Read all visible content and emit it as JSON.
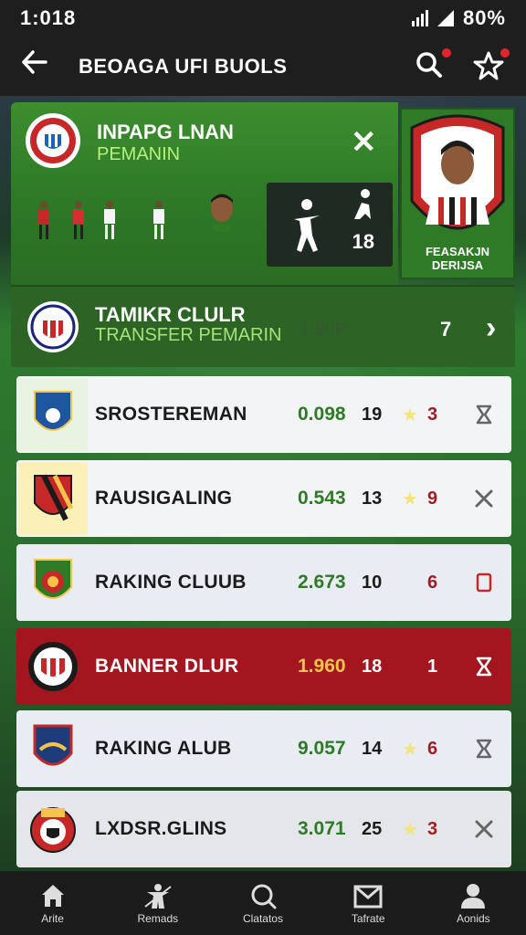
{
  "status": {
    "time": "1:018",
    "battery": "80%"
  },
  "appbar": {
    "title": "BEOAGA UFI BUOLS"
  },
  "promo": {
    "title": "INPAPG LNAN",
    "subtitle": "PEMANIN",
    "stat_number": "18",
    "side_caption": "FEASAKJN DERIJSA"
  },
  "transfer": {
    "title": "TAMIKR CLULR",
    "subtitle": "TRANSFER PEMARIN",
    "value": "1.90P",
    "count": "7"
  },
  "rows": [
    {
      "name": "SROSTEREMAN",
      "value": "0.098",
      "rank": "19",
      "points": "3",
      "star": true,
      "action_icon": "hourglass-icon"
    },
    {
      "name": "RAUSIGALING",
      "value": "0.543",
      "rank": "13",
      "points": "9",
      "star": true,
      "action_icon": "close-icon"
    },
    {
      "name": "RAKING CLUUB",
      "value": "2.673",
      "rank": "10",
      "points": "6",
      "star": false,
      "action_icon": "square-icon"
    },
    {
      "name": "BANNER DLUR",
      "value": "1.960",
      "rank": "18",
      "points": "1",
      "star": false,
      "action_icon": "hourglass-icon"
    },
    {
      "name": "RAKING ALUB",
      "value": "9.057",
      "rank": "14",
      "points": "6",
      "star": true,
      "action_icon": "hourglass-icon"
    },
    {
      "name": "LXDSR.GLINS",
      "value": "3.071",
      "rank": "25",
      "points": "3",
      "star": true,
      "action_icon": "close-icon"
    }
  ],
  "bottom_nav": [
    {
      "label": "Arite",
      "icon": "home-icon"
    },
    {
      "label": "Remads",
      "icon": "player-icon"
    },
    {
      "label": "Clatatos",
      "icon": "search-icon"
    },
    {
      "label": "Tafrate",
      "icon": "mail-icon"
    },
    {
      "label": "Aonids",
      "icon": "person-icon"
    }
  ],
  "colors": {
    "green": "#2e7a27",
    "red_row": "#a3161f",
    "accent_text": "#b7f07a"
  }
}
